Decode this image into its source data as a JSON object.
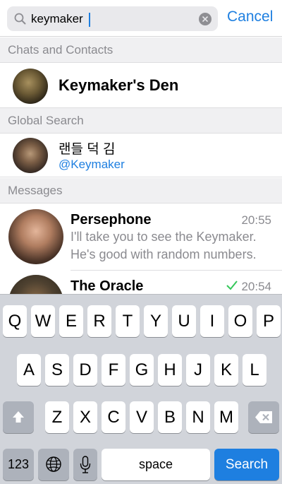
{
  "search": {
    "value": "keymaker",
    "cancel_label": "Cancel"
  },
  "sections": {
    "chats_and_contacts": "Chats and Contacts",
    "global_search": "Global Search",
    "messages": "Messages"
  },
  "chats": [
    {
      "name": "Keymaker's Den",
      "avatar": "group-photo"
    }
  ],
  "global_results": [
    {
      "name": "랜들 덕 김",
      "username": "@Keymaker",
      "avatar": "user-photo"
    }
  ],
  "messages": [
    {
      "sender": "Persephone",
      "time": "20:55",
      "text": "I'll take you to see the Keymaker. He's good with random numbers.",
      "avatar": "user-photo"
    },
    {
      "sender": "The Oracle",
      "time": "20:54",
      "status_icon": "checkmark-icon",
      "avatar": "user-photo"
    }
  ],
  "keyboard": {
    "row1": [
      "Q",
      "W",
      "E",
      "R",
      "T",
      "Y",
      "U",
      "I",
      "O",
      "P"
    ],
    "row2": [
      "A",
      "S",
      "D",
      "F",
      "G",
      "H",
      "J",
      "K",
      "L"
    ],
    "row3": [
      "Z",
      "X",
      "C",
      "V",
      "B",
      "N",
      "M"
    ],
    "numbers_key": "123",
    "space_key": "space",
    "search_key": "Search"
  },
  "colors": {
    "accent": "#1e7fe0",
    "secondary_text": "#8a8a8f",
    "section_bg": "#f0f0f2",
    "keyboard_bg": "#d1d4da",
    "status_check": "#34c759"
  }
}
